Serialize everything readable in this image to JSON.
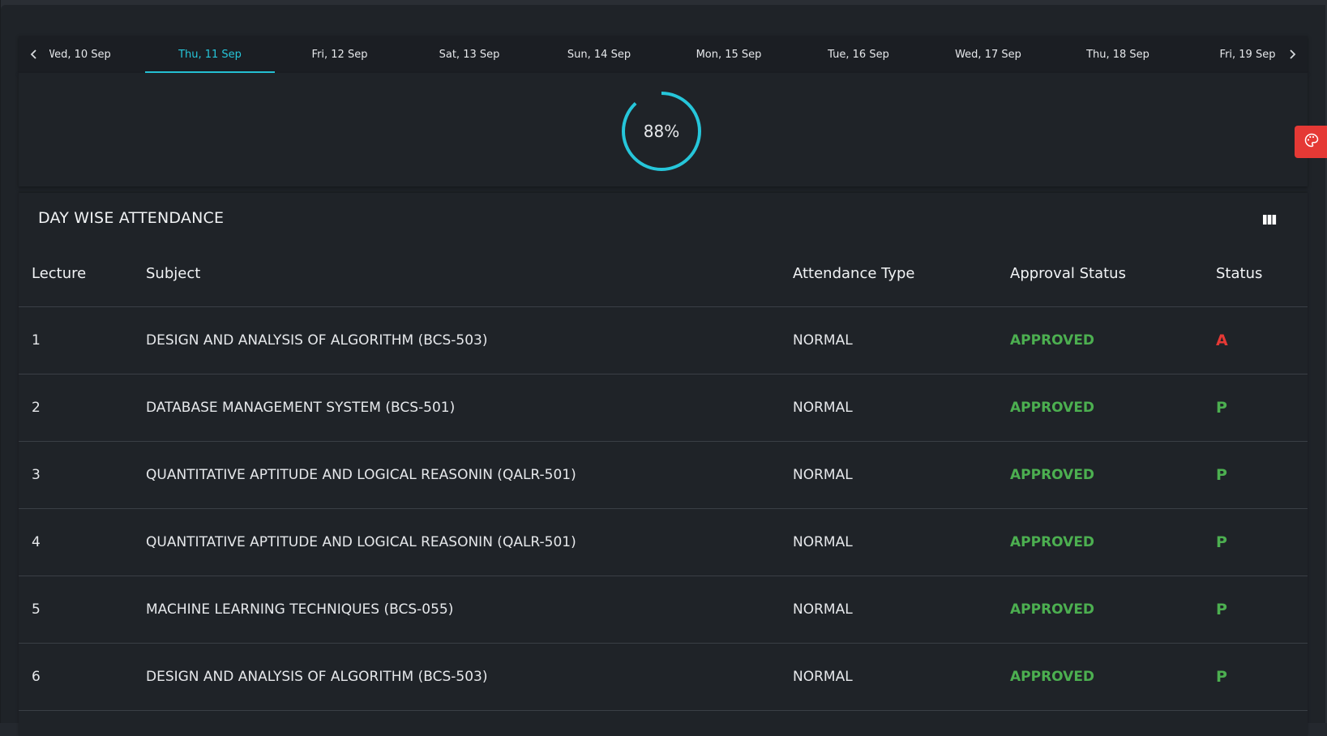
{
  "date_tabs": {
    "prev_icon": "chevron-left-icon",
    "next_icon": "chevron-right-icon",
    "items": [
      {
        "label": "Wed, 10 Sep"
      },
      {
        "label": "Thu, 11 Sep"
      },
      {
        "label": "Fri, 12 Sep"
      },
      {
        "label": "Sat, 13 Sep"
      },
      {
        "label": "Sun, 14 Sep"
      },
      {
        "label": "Mon, 15 Sep"
      },
      {
        "label": "Tue, 16 Sep"
      },
      {
        "label": "Wed, 17 Sep"
      },
      {
        "label": "Thu, 18 Sep"
      },
      {
        "label": "Fri, 19 Sep"
      }
    ],
    "active_index": 1
  },
  "progress": {
    "value": 88,
    "label": "88%",
    "color": "#26c6da"
  },
  "theme_button": {
    "icon": "palette-icon",
    "color": "#e53935"
  },
  "attendance": {
    "title": "DAY WISE ATTENDANCE",
    "columns_icon": "view-columns-icon",
    "headers": {
      "lecture": "Lecture",
      "subject": "Subject",
      "attendance_type": "Attendance Type",
      "approval_status": "Approval Status",
      "status": "Status"
    },
    "rows": [
      {
        "lecture": "1",
        "subject": "DESIGN AND ANALYSIS OF ALGORITHM (BCS-503)",
        "type": "NORMAL",
        "approval": "APPROVED",
        "status": "A"
      },
      {
        "lecture": "2",
        "subject": "DATABASE MANAGEMENT SYSTEM (BCS-501)",
        "type": "NORMAL",
        "approval": "APPROVED",
        "status": "P"
      },
      {
        "lecture": "3",
        "subject": "QUANTITATIVE APTITUDE AND LOGICAL REASONIN (QALR-501)",
        "type": "NORMAL",
        "approval": "APPROVED",
        "status": "P"
      },
      {
        "lecture": "4",
        "subject": "QUANTITATIVE APTITUDE AND LOGICAL REASONIN (QALR-501)",
        "type": "NORMAL",
        "approval": "APPROVED",
        "status": "P"
      },
      {
        "lecture": "5",
        "subject": "MACHINE LEARNING TECHNIQUES (BCS-055)",
        "type": "NORMAL",
        "approval": "APPROVED",
        "status": "P"
      },
      {
        "lecture": "6",
        "subject": "DESIGN AND ANALYSIS OF ALGORITHM (BCS-503)",
        "type": "NORMAL",
        "approval": "APPROVED",
        "status": "P"
      }
    ],
    "colors": {
      "approved": "#4caf50",
      "absent": "#e53935",
      "present": "#4caf50"
    }
  }
}
